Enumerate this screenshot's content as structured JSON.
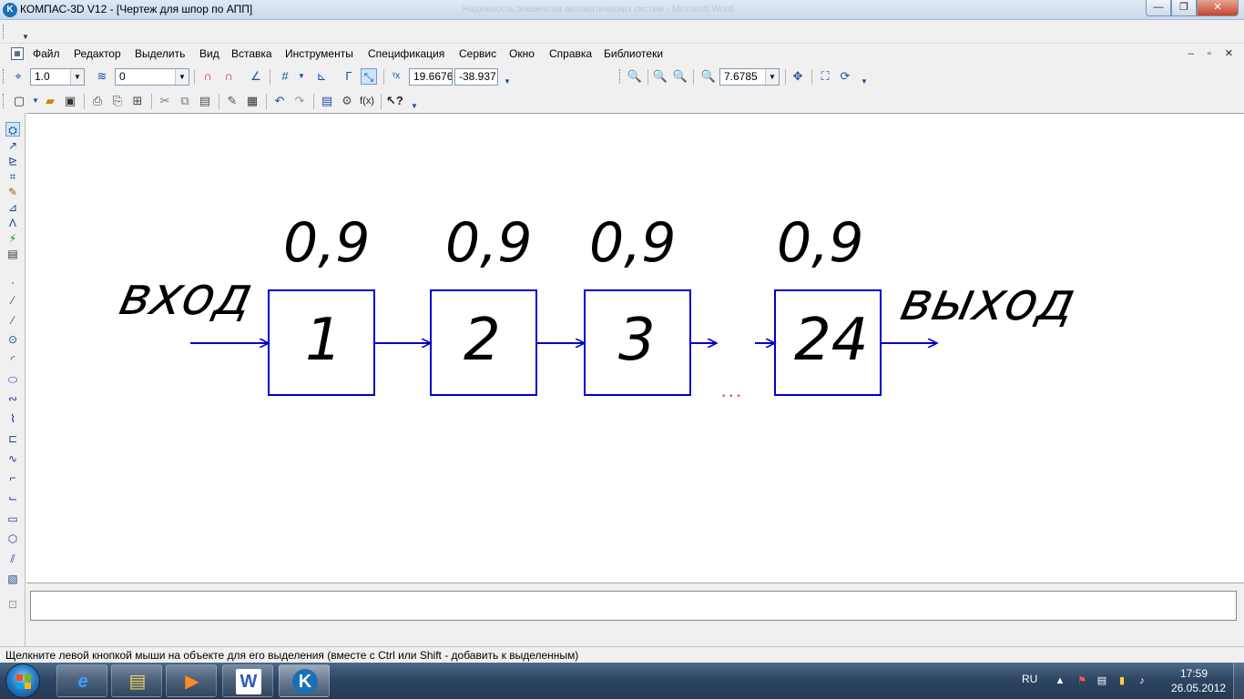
{
  "window": {
    "title": "КОМПАС-3D V12 - [Чертеж для шпор по АПП]",
    "background_title": "Надёжность элементов автоматических систем - Microsoft Word",
    "min_label": "—",
    "max_label": "❐",
    "close_label": "✕"
  },
  "menu": {
    "items": [
      "Файл",
      "Редактор",
      "Выделить",
      "Вид",
      "Вставка",
      "Инструменты",
      "Спецификация",
      "Сервис",
      "Окно",
      "Справка",
      "Библиотеки"
    ],
    "mdi_controls": "– ▫ ✕"
  },
  "toolbar_current": {
    "line_style": "1.0",
    "layer": "0",
    "coord_x": "19.6676",
    "coord_y": "-38.937"
  },
  "toolbar_view": {
    "zoom": "7.6785"
  },
  "drawing": {
    "input_label": "вход",
    "output_label": "выход",
    "ellipsis": "• • •",
    "blocks": [
      {
        "number": "1",
        "reliability": "0,9"
      },
      {
        "number": "2",
        "reliability": "0,9"
      },
      {
        "number": "3",
        "reliability": "0,9"
      },
      {
        "number": "24",
        "reliability": "0,9"
      }
    ],
    "line_color": "#0000c8"
  },
  "status": {
    "message": "Щелкните левой кнопкой мыши на объекте для его выделения (вместе с Ctrl или Shift - добавить к выделенным)"
  },
  "taskbar": {
    "lang": "RU",
    "time": "17:59",
    "date": "26.05.2012",
    "apps": [
      {
        "name": "internet-explorer",
        "glyph": "e"
      },
      {
        "name": "file-explorer",
        "glyph": "▤"
      },
      {
        "name": "media-player",
        "glyph": "▶"
      },
      {
        "name": "word",
        "glyph": "W"
      },
      {
        "name": "kompas",
        "glyph": "K"
      }
    ]
  }
}
